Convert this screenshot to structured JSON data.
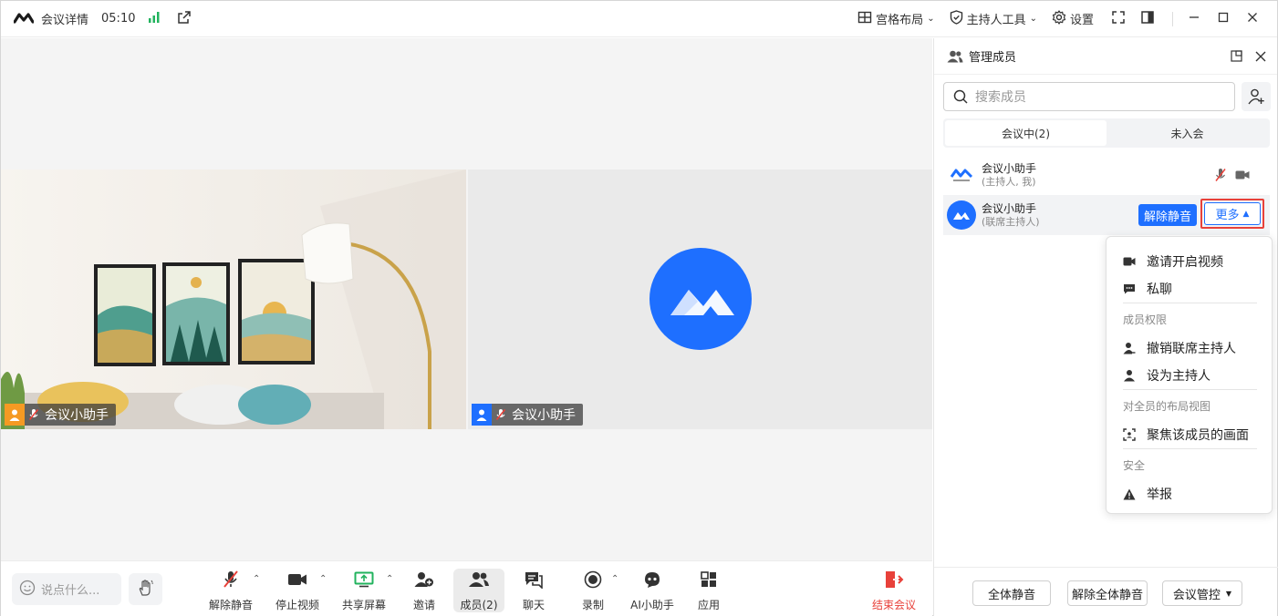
{
  "topbar": {
    "title": "会议详情",
    "timer": "05:10",
    "layout_label": "宫格布局",
    "host_tools_label": "主持人工具",
    "settings_label": "设置"
  },
  "stage": {
    "tiles": [
      {
        "name": "会议小助手",
        "avatar_color": "#f59a23"
      },
      {
        "name": "会议小助手",
        "avatar_color": "#1e6fff"
      }
    ]
  },
  "toolbar": {
    "chat_placeholder": "说点什么...",
    "buttons": {
      "unmute": "解除静音",
      "stop_video": "停止视频",
      "share": "共享屏幕",
      "invite": "邀请",
      "members": "成员(2)",
      "chat": "聊天",
      "record": "录制",
      "ai": "AI小助手",
      "apps": "应用",
      "end": "结束会议"
    }
  },
  "panel": {
    "title": "管理成员",
    "search_placeholder": "搜索成员",
    "tabs": [
      "会议中(2)",
      "未入会"
    ],
    "members": [
      {
        "name": "会议小助手",
        "role": "(主持人, 我)"
      },
      {
        "name": "会议小助手",
        "role": "(联席主持人)",
        "unmute_label": "解除静音",
        "more_label": "更多"
      }
    ],
    "footer": {
      "mute_all": "全体静音",
      "unmute_all": "解除全体静音",
      "meeting_control": "会议管控"
    }
  },
  "menu": {
    "items_top": [
      "邀请开启视频",
      "私聊"
    ],
    "section_permissions": "成员权限",
    "items_permissions": [
      "撤销联席主持人",
      "设为主持人"
    ],
    "section_layout": "对全员的布局视图",
    "items_layout": [
      "聚焦该成员的画面"
    ],
    "section_security": "安全",
    "items_security": [
      "举报"
    ]
  },
  "colors": {
    "accent": "#1e6fff",
    "end_red": "#e8413a",
    "signal_green": "#22b35e"
  }
}
